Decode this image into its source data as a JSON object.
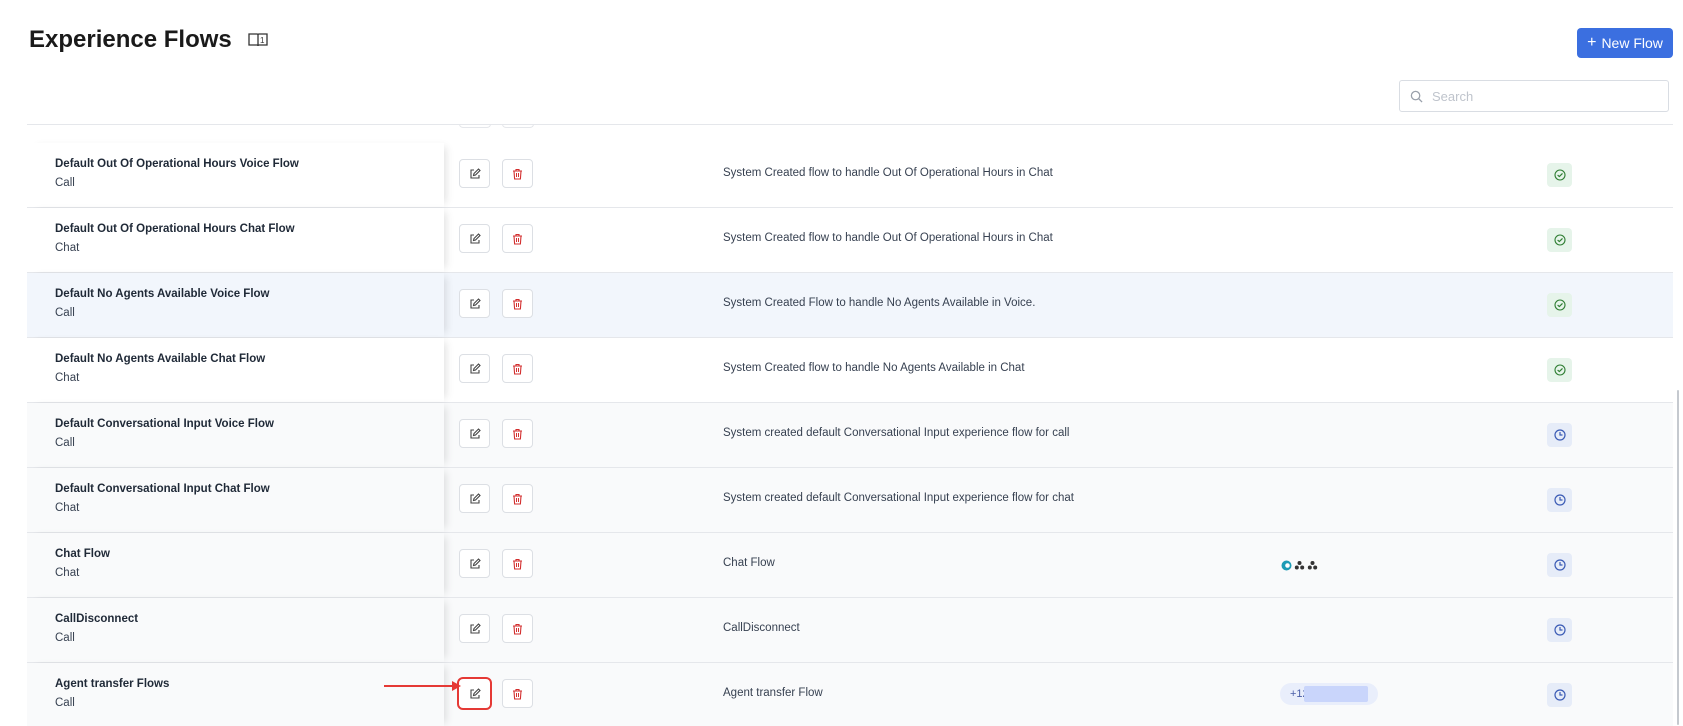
{
  "header": {
    "title": "Experience Flows",
    "new_flow_label": "New Flow",
    "new_flow_icon": "plus-icon",
    "docs_icon": "book-icon"
  },
  "search": {
    "placeholder": "Search",
    "value": ""
  },
  "colors": {
    "primary": "#3b6fe0",
    "delete": "#d32f2f",
    "status_active": "#2e7d32",
    "status_pending": "#3b5bb5",
    "highlight": "#e53935"
  },
  "rows": [
    {
      "name": "Default Out Of Operational Hours Voice Flow",
      "type": "Call",
      "description": "System Created flow to handle Out Of Operational Hours in Chat",
      "status": "active",
      "status_icon": "check-circle-icon"
    },
    {
      "name": "Default Out Of Operational Hours Chat Flow",
      "type": "Chat",
      "description": "System Created flow to handle Out Of Operational Hours in Chat",
      "status": "active",
      "status_icon": "check-circle-icon"
    },
    {
      "name": "Default No Agents Available Voice Flow",
      "type": "Call",
      "description": "System Created Flow to handle No Agents Available in Voice.",
      "status": "active",
      "status_icon": "check-circle-icon"
    },
    {
      "name": "Default No Agents Available Chat Flow",
      "type": "Chat",
      "description": "System Created flow to handle No Agents Available in Chat",
      "status": "active",
      "status_icon": "check-circle-icon"
    },
    {
      "name": "Default Conversational Input Voice Flow",
      "type": "Call",
      "description": "System created default Conversational Input experience flow for call",
      "status": "pending",
      "status_icon": "clock-icon"
    },
    {
      "name": "Default Conversational Input Chat Flow",
      "type": "Chat",
      "description": "System created default Conversational Input experience flow for chat",
      "status": "pending",
      "status_icon": "clock-icon"
    },
    {
      "name": "Chat Flow",
      "type": "Chat",
      "description": "Chat Flow",
      "status": "pending",
      "status_icon": "clock-icon",
      "channels": [
        "channel-app-icon",
        "channel-people-icon",
        "channel-people-icon"
      ]
    },
    {
      "name": "CallDisconnect",
      "type": "Call",
      "description": "CallDisconnect",
      "status": "pending",
      "status_icon": "clock-icon"
    },
    {
      "name": "Agent transfer Flows",
      "type": "Call",
      "description": "Agent transfer Flow",
      "status": "pending",
      "status_icon": "clock-icon",
      "phone": "+12",
      "focused_action": "edit"
    }
  ],
  "actions": {
    "edit_icon": "edit-icon",
    "delete_icon": "trash-icon"
  }
}
